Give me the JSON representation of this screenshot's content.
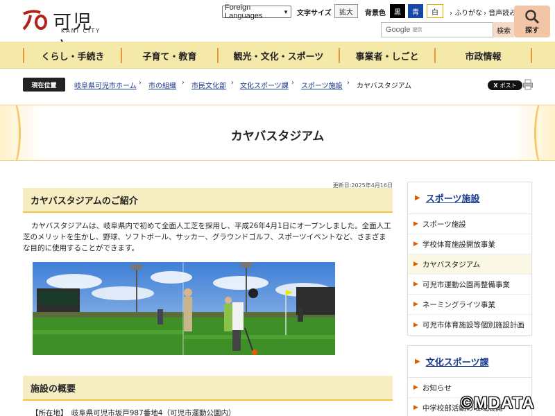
{
  "header": {
    "logo_main": "可児市",
    "logo_sub": "KANI CITY",
    "language_select": "Foreign Languages",
    "font_size_label": "文字サイズ",
    "zoom_label": "拡大",
    "bg_color_label": "背景色",
    "bg_black": "黒",
    "bg_blue": "青",
    "bg_white": "白",
    "furigana": "ふりがな",
    "voice": "音声読み",
    "search_google": "Google",
    "search_provided": "提供",
    "search_button": "検索",
    "find_button": "探す"
  },
  "gnav": [
    "くらし・手続き",
    "子育て・教育",
    "観光・文化・スポーツ",
    "事業者・しごと",
    "市政情報"
  ],
  "breadcrumb": {
    "label": "現在位置",
    "items": [
      "岐阜県可児市ホーム",
      "市の組織",
      "市民文化部",
      "文化スポーツ課",
      "スポーツ施設",
      "カヤバスタジアム"
    ],
    "post_label": "ポスト"
  },
  "page": {
    "title": "カヤバスタジアム",
    "updated": "更新日:2025年4月16日",
    "section1_title": "カヤバスタジアムのご紹介",
    "intro": "カヤバスタジアムは、岐阜県内で初めて全面人工芝を採用し、平成26年4月1日にオープンしました。全面人工芝のメリットを生かし、野球、ソフトボール、サッカー、グラウンドゴルフ、スポーツイベントなど、さまざまな目的に使用することができます。",
    "section2_title": "施設の概要",
    "address": "【所在地】　岐阜県可児市坂戸987番地4（可児市運動公園内）"
  },
  "sidebar": {
    "box1": {
      "title": "スポーツ施設",
      "items": [
        "スポーツ施設",
        "学校体育施設開放事業",
        "カヤバスタジアム",
        "可児市運動公園再整備事業",
        "ネーミングライツ事業",
        "可児市体育施設等個別施設計画"
      ]
    },
    "box2": {
      "title": "文化スポーツ課",
      "items": [
        "お知らせ",
        "中学校部活動の地域展開"
      ]
    }
  },
  "watermark": "©MDATA",
  "colors": {
    "nav_bg": "#f5e9a9",
    "nav_sep": "#e39a3e",
    "heading_bg": "#f6edc2",
    "heading_border": "#f0c53b",
    "link": "#1a3a8f",
    "arrow": "#e05a00"
  }
}
